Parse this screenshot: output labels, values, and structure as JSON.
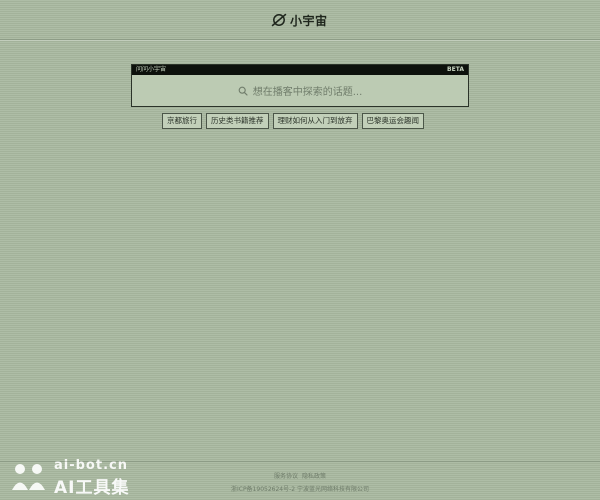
{
  "header": {
    "logo_text": "小宇宙",
    "logo_icon": "planet-icon"
  },
  "search": {
    "card_label": "问问小宇宙",
    "badge": "BETA",
    "placeholder": "想在播客中探索的话题...",
    "icon": "search-icon"
  },
  "chips": [
    {
      "label": "京都旅行"
    },
    {
      "label": "历史类书籍推荐"
    },
    {
      "label": "理财如何从入门到放弃"
    },
    {
      "label": "巴黎奥运会趣闻"
    }
  ],
  "footer": {
    "links": [
      "服务协议",
      "隐私政策"
    ],
    "legal": "浙ICP备19052624号-2 宁波蓝光网络科技有限公司"
  },
  "watermark": {
    "domain": "ai-bot.cn",
    "name": "AI工具集"
  },
  "colors": {
    "background": "#a9b9a0",
    "card_header": "#0d110c",
    "text": "#2b3329"
  }
}
